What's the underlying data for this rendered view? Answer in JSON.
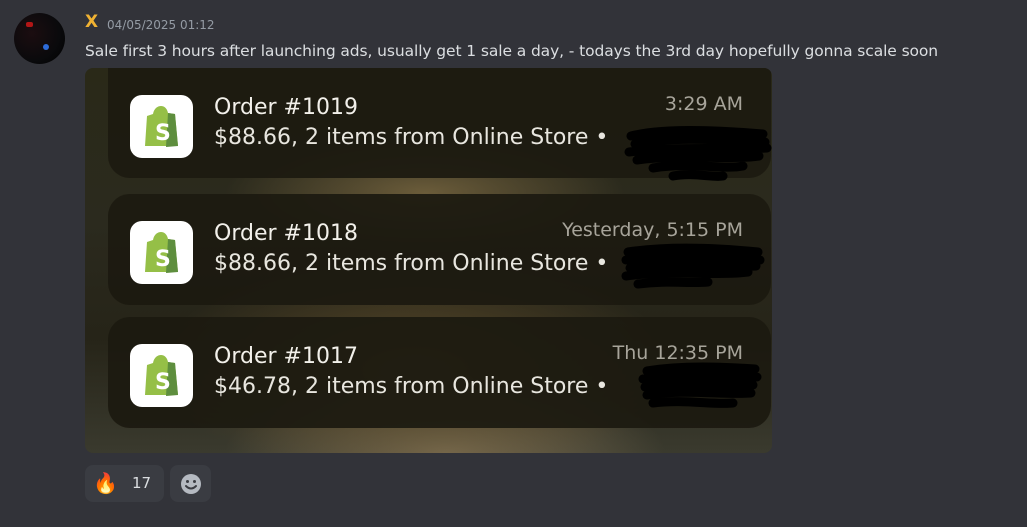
{
  "message": {
    "username": "X",
    "timestamp": "04/05/2025 01:12",
    "text": "Sale first 3 hours after launching ads, usually get 1 sale a day, - todays the 3rd day hopefully gonna scale soon"
  },
  "notifications": [
    {
      "title": "Order #1019",
      "subtitle": "$88.66, 2 items from Online Store •",
      "time": "3:29 AM",
      "icon": "shopify-bag-icon"
    },
    {
      "title": "Order #1018",
      "subtitle": "$88.66, 2 items from Online Store •",
      "time": "Yesterday, 5:15 PM",
      "icon": "shopify-bag-icon"
    },
    {
      "title": "Order #1017",
      "subtitle": "$46.78, 2 items from Online Store •",
      "time": "Thu 12:35 PM",
      "icon": "shopify-bag-icon"
    }
  ],
  "reactions": [
    {
      "emoji": "🔥",
      "count": "17"
    }
  ],
  "add_reaction_icon": "smiley-add-reaction-icon",
  "colors": {
    "background": "#323339",
    "username": "#f0b232",
    "shopify_green": "#95bf47"
  }
}
